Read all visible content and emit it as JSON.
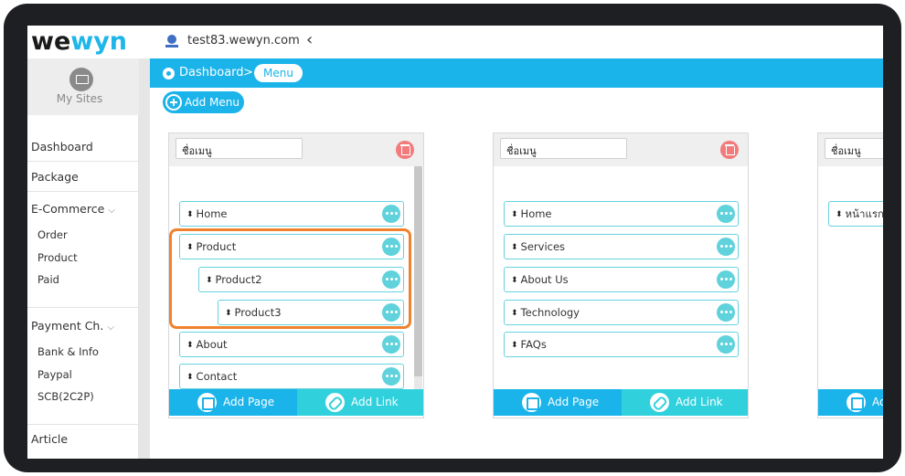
{
  "app": {
    "logo_left": "we",
    "logo_accent": "wyn",
    "site_url": "test83.wewyn.com",
    "brand_color": "#1ab3ea",
    "accent_color": "#30d1dd"
  },
  "sidebar": {
    "my_sites_label": "My Sites",
    "dashboard": "Dashboard",
    "package": "Package",
    "ecommerce": "E-Commerce",
    "ecommerce_items": [
      "Order",
      "Product",
      "Paid"
    ],
    "payment": "Payment Ch.",
    "payment_items": [
      "Bank & Info",
      "Paypal",
      "SCB(2C2P)"
    ],
    "article": "Article"
  },
  "breadcrumb": {
    "dashboard": "Dashboard",
    "separator": ">",
    "current": "Menu"
  },
  "toolbar": {
    "add_menu_label": "Add  Menu"
  },
  "panels": [
    {
      "name": "ชื่อเมนู",
      "items": [
        {
          "label": "Home",
          "level": 0
        },
        {
          "label": "Product",
          "level": 0
        },
        {
          "label": "Product2",
          "level": 1
        },
        {
          "label": "Product3",
          "level": 2
        },
        {
          "label": "About",
          "level": 0
        },
        {
          "label": "Contact",
          "level": 0
        }
      ],
      "add_page_label": "Add Page",
      "add_link_label": "Add Link"
    },
    {
      "name": "ชื่อเมนู",
      "items": [
        {
          "label": "Home",
          "level": 0
        },
        {
          "label": "Services",
          "level": 0
        },
        {
          "label": "About Us",
          "level": 0
        },
        {
          "label": "Technology",
          "level": 0
        },
        {
          "label": "FAQs",
          "level": 0
        }
      ],
      "add_page_label": "Add Page",
      "add_link_label": "Add Link"
    },
    {
      "name": "ชื่อเมนู",
      "items": [
        {
          "label": "หน้าแรก",
          "level": 0
        }
      ],
      "add_page_label": "Ad",
      "add_link_label": ""
    }
  ]
}
